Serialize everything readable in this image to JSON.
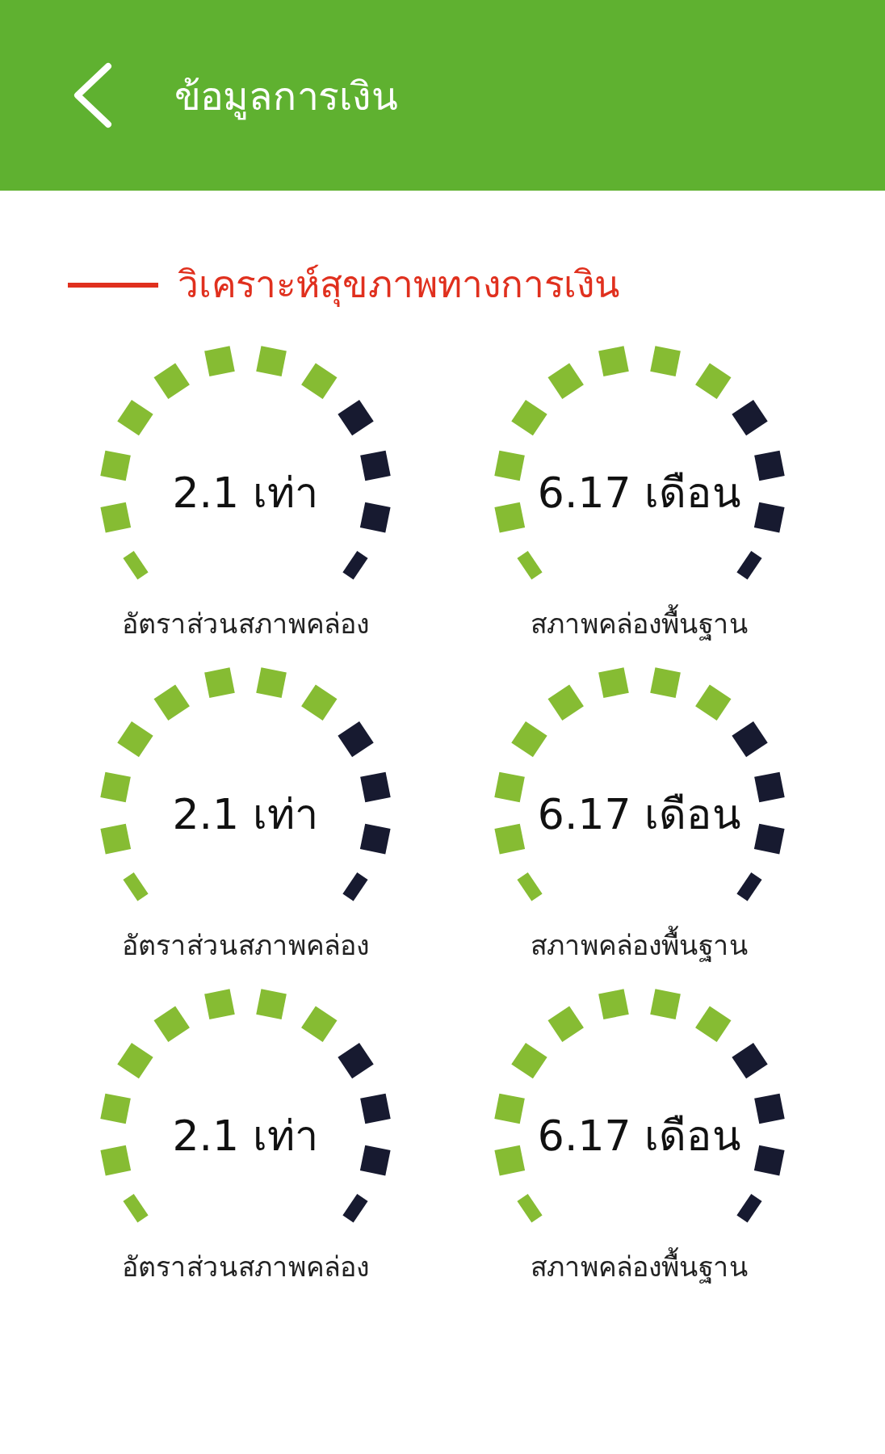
{
  "header": {
    "title": "ข้อมูลการเงิน"
  },
  "section": {
    "title": "วิเคราะห์สุขภาพทางการเงิน"
  },
  "gauges": [
    {
      "value": "2.1 เท่า",
      "label": "อัตราส่วนสภาพคล่อง",
      "level": 0.667
    },
    {
      "value": "6.17 เดือน",
      "label": "สภาพคล่องพื้นฐาน",
      "level": 0.667
    },
    {
      "value": "2.1 เท่า",
      "label": "อัตราส่วนสภาพคล่อง",
      "level": 0.667
    },
    {
      "value": "6.17 เดือน",
      "label": "สภาพคล่องพื้นฐาน",
      "level": 0.667
    },
    {
      "value": "2.1 เท่า",
      "label": "อัตราส่วนสภาพคล่อง",
      "level": 0.667
    },
    {
      "value": "6.17 เดือน",
      "label": "สภาพคล่องพื้นฐาน",
      "level": 0.667
    }
  ]
}
